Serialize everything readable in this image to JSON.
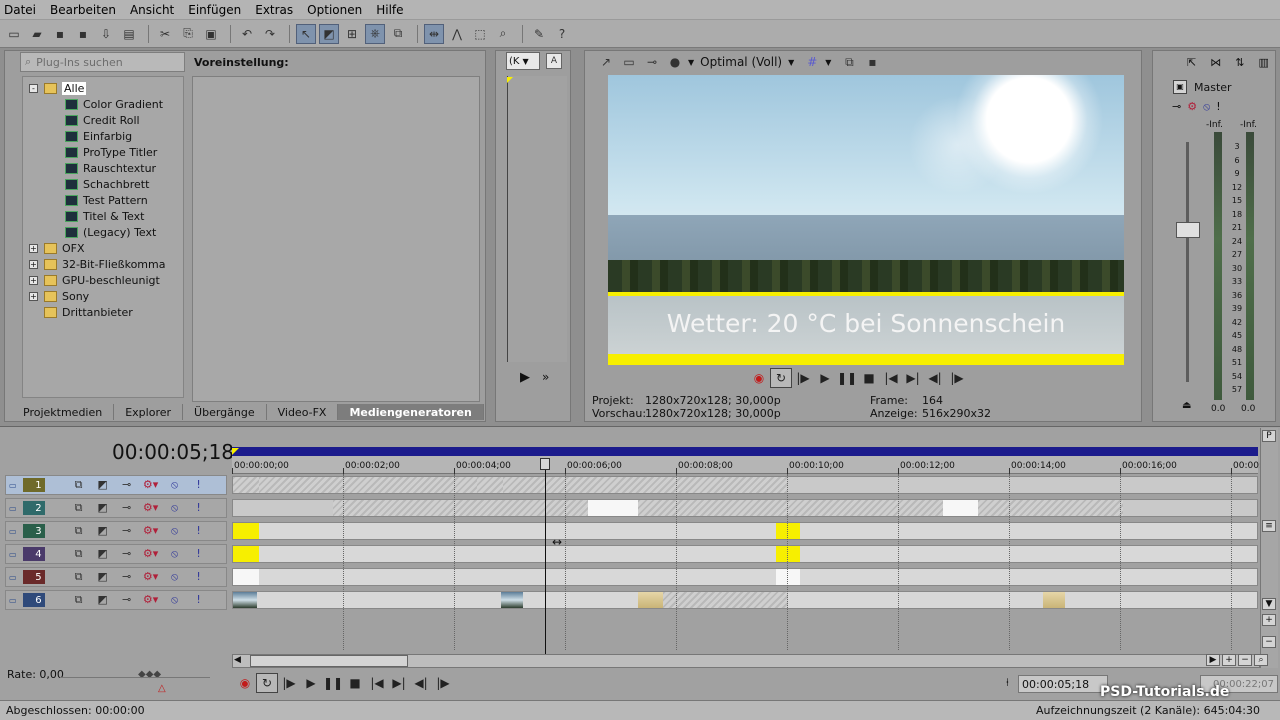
{
  "menu": [
    "Datei",
    "Bearbeiten",
    "Ansicht",
    "Einfügen",
    "Extras",
    "Optionen",
    "Hilfe"
  ],
  "plugins": {
    "search_placeholder": "Plug-Ins suchen",
    "preset_label": "Voreinstellung:",
    "tree": [
      {
        "label": "Alle",
        "level": 0,
        "type": "folder",
        "expand": "-",
        "selected": true
      },
      {
        "label": "Color Gradient",
        "level": 1,
        "type": "gen"
      },
      {
        "label": "Credit Roll",
        "level": 1,
        "type": "gen"
      },
      {
        "label": "Einfarbig",
        "level": 1,
        "type": "gen"
      },
      {
        "label": "ProType Titler",
        "level": 1,
        "type": "gen"
      },
      {
        "label": "Rauschtextur",
        "level": 1,
        "type": "gen"
      },
      {
        "label": "Schachbrett",
        "level": 1,
        "type": "gen"
      },
      {
        "label": "Test Pattern",
        "level": 1,
        "type": "gen"
      },
      {
        "label": "Titel & Text",
        "level": 1,
        "type": "gen"
      },
      {
        "label": "(Legacy) Text",
        "level": 1,
        "type": "gen"
      },
      {
        "label": "OFX",
        "level": 0,
        "type": "folder",
        "expand": "+"
      },
      {
        "label": "32-Bit-Fließkomma",
        "level": 0,
        "type": "folder",
        "expand": "+"
      },
      {
        "label": "GPU-beschleunigt",
        "level": 0,
        "type": "folder",
        "expand": "+"
      },
      {
        "label": "Sony",
        "level": 0,
        "type": "folder",
        "expand": "+"
      },
      {
        "label": "Drittanbieter",
        "level": 0,
        "type": "folder",
        "expand": ""
      }
    ]
  },
  "tabs": [
    "Projektmedien",
    "Explorer",
    "Übergänge",
    "Video-FX",
    "Mediengeneratoren"
  ],
  "trimmer_select": "(K",
  "preview": {
    "quality": "Optimal (Voll)",
    "overlay_text": "Wetter: 20 °C bei Sonnenschein",
    "info": {
      "projekt_label": "Projekt:",
      "projekt_value": "1280x720x128; 30,000p",
      "vorschau_label": "Vorschau:",
      "vorschau_value": "1280x720x128; 30,000p",
      "frame_label": "Frame:",
      "frame_value": "164",
      "anzeige_label": "Anzeige:",
      "anzeige_value": "516x290x32"
    }
  },
  "mixer": {
    "label": "Master",
    "inf_left": "-Inf.",
    "inf_right": "-Inf.",
    "zero_left": "0.0",
    "zero_right": "0.0",
    "scale": [
      "3",
      "6",
      "9",
      "12",
      "15",
      "18",
      "21",
      "24",
      "27",
      "30",
      "33",
      "36",
      "39",
      "42",
      "45",
      "48",
      "51",
      "54",
      "57"
    ]
  },
  "timeline": {
    "timecode": "00:00:05;18",
    "ruler": [
      "00:00:00;00",
      "00:00:02;00",
      "00:00:04;00",
      "00:00:06;00",
      "00:00:08;00",
      "00:00:10;00",
      "00:00:12;00",
      "00:00:14;00",
      "00:00:16;00",
      "00:00:"
    ],
    "tracks": [
      {
        "num": "1",
        "color": "#6f6a2a"
      },
      {
        "num": "2",
        "color": "#2f6a6a"
      },
      {
        "num": "3",
        "color": "#2a5f4a"
      },
      {
        "num": "4",
        "color": "#4a3a6a"
      },
      {
        "num": "5",
        "color": "#6a2a2a"
      },
      {
        "num": "6",
        "color": "#2f4a7a"
      }
    ]
  },
  "bottom": {
    "rate": "Rate: 0,00",
    "cursor_tc": "00:00:05;18",
    "end_tc": "00:00:22;07",
    "status_left": "Abgeschlossen: 00:00:00",
    "status_right": "Aufzeichnungszeit (2 Kanäle): 645:04:30",
    "logo": "PSD-Tutorials.de"
  }
}
